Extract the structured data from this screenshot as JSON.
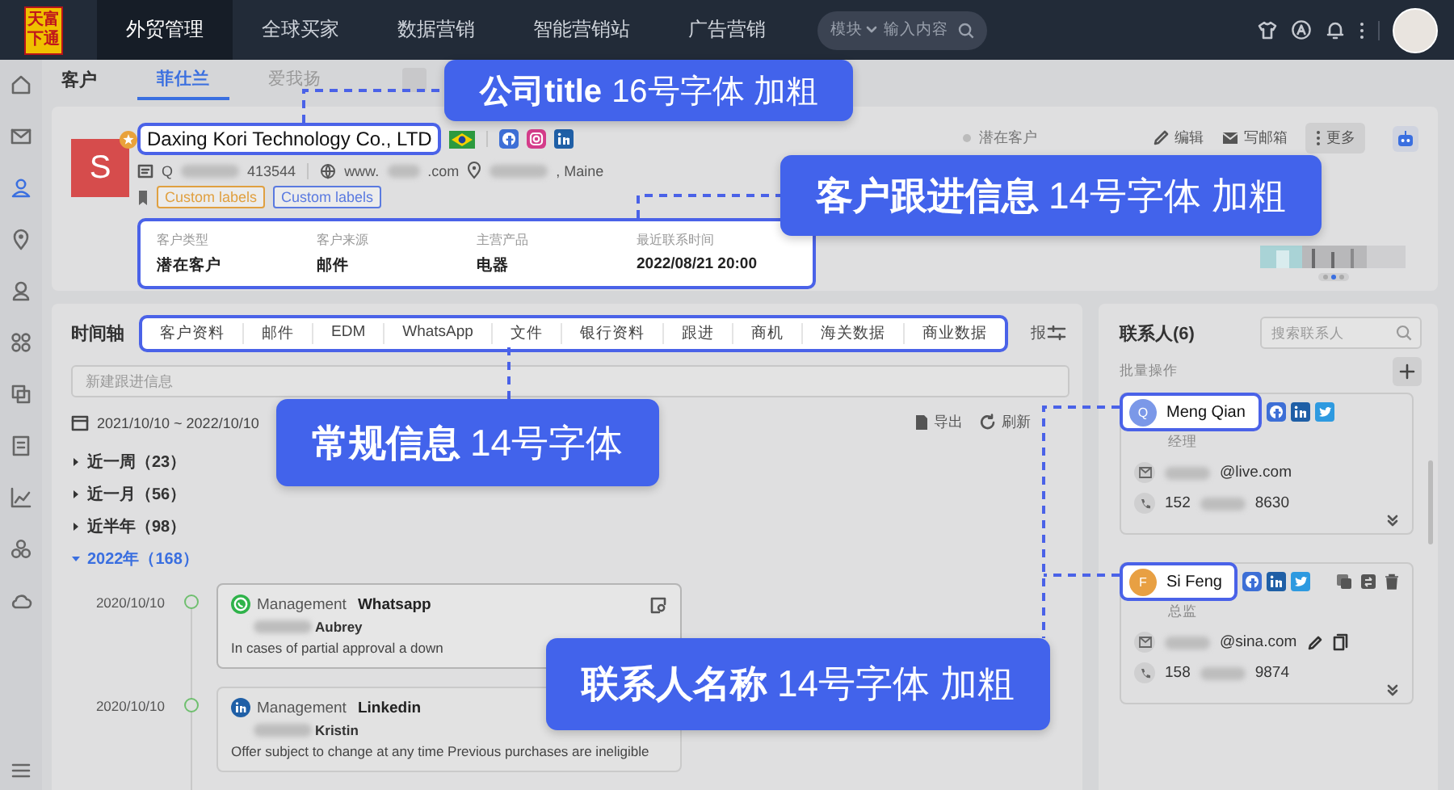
{
  "top_nav": {
    "logo": [
      "天富",
      "下通"
    ],
    "items": [
      {
        "label": "外贸管理",
        "selected": true
      },
      {
        "label": "全球买家",
        "selected": false
      },
      {
        "label": "数据营销",
        "selected": false
      },
      {
        "label": "智能营销站",
        "selected": false
      },
      {
        "label": "广告营销",
        "selected": false
      }
    ],
    "search": {
      "scope": "模块",
      "placeholder": "输入内容"
    }
  },
  "sidebar": [
    {
      "selected": false
    },
    {
      "selected": false
    },
    {
      "selected": true
    },
    {
      "selected": false
    },
    {
      "selected": false
    },
    {
      "selected": false
    },
    {
      "selected": false
    },
    {
      "selected": false
    },
    {
      "selected": false
    },
    {
      "selected": false
    },
    {
      "selected": false
    }
  ],
  "section_title": "客户",
  "tabs": [
    {
      "label": "菲仕兰",
      "selected": true
    },
    {
      "label": "爱我扬",
      "selected": false
    }
  ],
  "customer": {
    "initial": "S",
    "starred": true,
    "name": "Daxing Kori Technology Co., LTD",
    "tax_id": {
      "start": "Q",
      "end": "413544"
    },
    "website": {
      "start": "www.",
      "end": ".com"
    },
    "address": {
      "end": ", Maine"
    },
    "labels": [
      {
        "text": "Custom labels",
        "color": "#e0a040"
      },
      {
        "text": "Custom labels",
        "color": "#5a7ae0"
      }
    ],
    "info": [
      {
        "label": "客户类型",
        "value": "潜在客户"
      },
      {
        "label": "客户来源",
        "value": "邮件"
      },
      {
        "label": "主营产品",
        "value": "电器"
      },
      {
        "label": "最近联系时间",
        "value": "2022/08/21 20:00"
      }
    ],
    "status": "潜在客户",
    "actions": [
      "编辑",
      "写邮箱",
      "更多"
    ],
    "carousel": [
      {
        "selected": false
      },
      {
        "selected": true
      },
      {
        "selected": false
      }
    ]
  },
  "timeline": {
    "title": "时间轴",
    "tabs": [
      "客户资料",
      "邮件",
      "EDM",
      "WhatsApp",
      "文件",
      "银行资料",
      "跟进",
      "商机",
      "海关数据",
      "商业数据"
    ],
    "cut_tab": "报",
    "input_placeholder": "新建跟进信息",
    "date_range": "2021/10/10 ~ 2022/10/10",
    "tools": [
      "导出",
      "刷新"
    ],
    "groups": [
      {
        "label": "近一周（23）",
        "expanded": false
      },
      {
        "label": "近一月（56）",
        "expanded": false
      },
      {
        "label": "近半年（98）",
        "expanded": false
      },
      {
        "label": "2022年（168）",
        "expanded": true,
        "entries": [
          {
            "kind": "whatsapp",
            "date": "2020/10/10",
            "user": "Management",
            "channel": "Whatsapp",
            "contact": "Aubrey",
            "note": "In cases of partial approval a down",
            "hovered": true
          },
          {
            "kind": "linkedin",
            "date": "2020/10/10",
            "user": "Management",
            "channel": "Linkedin",
            "contact": "Kristin",
            "note": "Offer subject to change at any time Previous purchases are ineligible",
            "hovered": false
          }
        ]
      }
    ]
  },
  "contacts": {
    "title": "联系人(6)",
    "search_placeholder": "搜索联系人",
    "batch": "批量操作",
    "items": [
      {
        "initial": "Q",
        "color": "#7b98e8",
        "name": "Meng Qian",
        "title": "经理",
        "email": {
          "end": "@live.com"
        },
        "phone": {
          "start": "152",
          "end": "8630"
        },
        "hovered": false
      },
      {
        "initial": "F",
        "color": "#e8a043",
        "name": "Si Feng",
        "title": "总监",
        "email": {
          "end": "@sina.com"
        },
        "phone": {
          "start": "158",
          "end": "9874"
        },
        "hovered": true
      }
    ]
  },
  "callouts": [
    "**公司title** 16号字体 加粗",
    "**客户跟进信息** 14号字体 加粗",
    "**常规信息** 14号字体",
    "**联系人名称** 14号字体 加粗"
  ]
}
